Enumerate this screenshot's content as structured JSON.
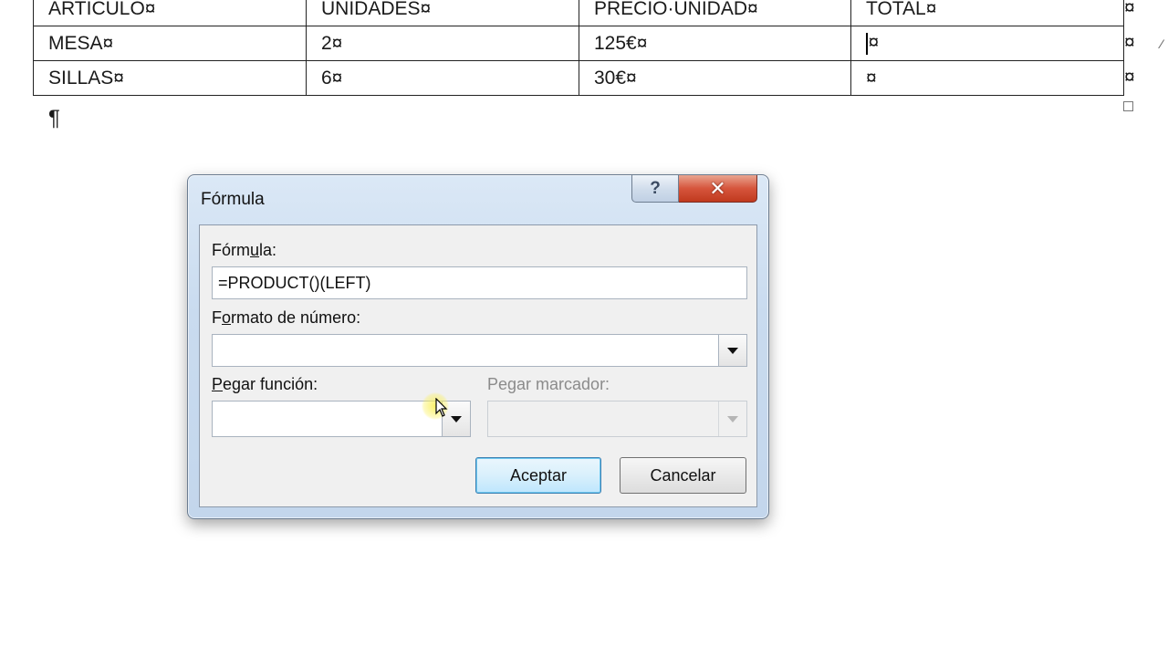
{
  "document": {
    "table": {
      "rows": [
        [
          "ARTICULO¤",
          "UNIDADES¤",
          "PRECIO·UNIDAD¤",
          "TOTAL¤"
        ],
        [
          "MESA¤",
          "2¤",
          "125€¤",
          "¤"
        ],
        [
          "SILLAS¤",
          "6¤",
          "30€¤",
          "¤"
        ]
      ],
      "row_end_marks": [
        "¤",
        "¤",
        "¤"
      ]
    },
    "paragraph_mark": "¶"
  },
  "dialog": {
    "title": "Fórmula",
    "help_button": "?",
    "close_button": "✕",
    "formula_label_pre": "Fórm",
    "formula_label_u": "u",
    "formula_label_post": "la:",
    "formula_value": "=PRODUCT()(LEFT)",
    "number_format_label_pre": "F",
    "number_format_label_u": "o",
    "number_format_label_post": "rmato de número:",
    "number_format_value": "",
    "paste_function_label_u": "P",
    "paste_function_label_post": "egar función:",
    "paste_function_value": "",
    "paste_bookmark_label": "Pegar marcador:",
    "paste_bookmark_value": "",
    "ok_button": "Aceptar",
    "cancel_button": "Cancelar"
  }
}
